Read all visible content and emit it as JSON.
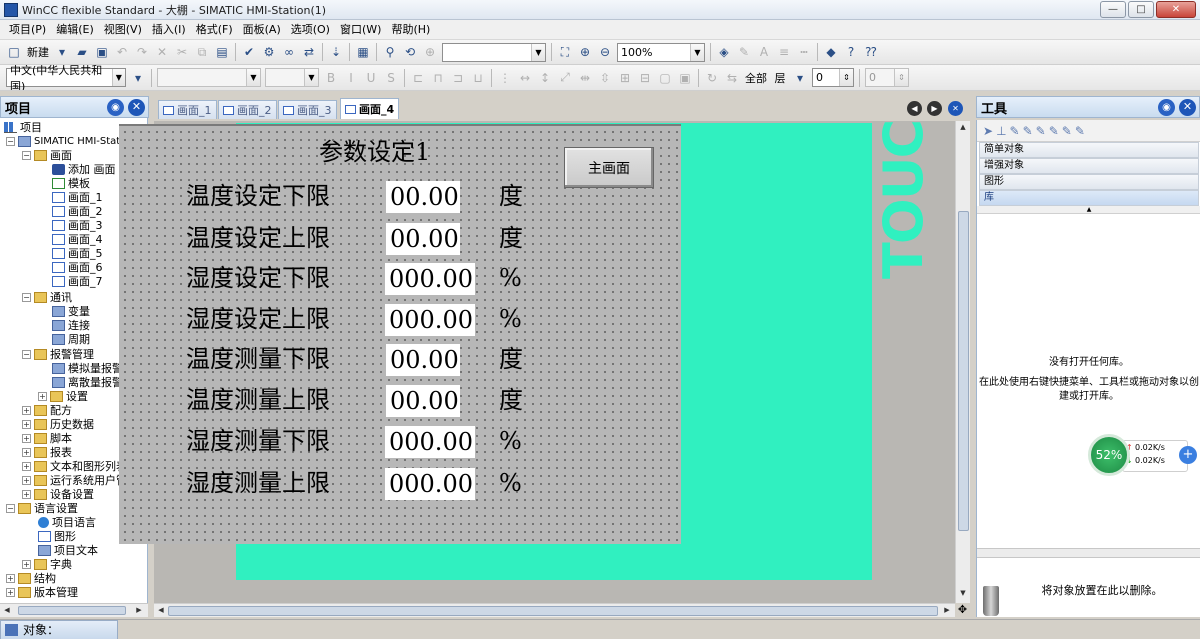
{
  "window": {
    "title": "WinCC flexible Standard - 大棚 - SIMATIC HMI-Station(1)",
    "min": "—",
    "max": "□",
    "close": "✕"
  },
  "menu": [
    "项目(P)",
    "编辑(E)",
    "视图(V)",
    "插入(I)",
    "格式(F)",
    "面板(A)",
    "选项(O)",
    "窗口(W)",
    "帮助(H)"
  ],
  "toolbar1": {
    "new_label": "新建",
    "zoom_value": "100%"
  },
  "toolbar2": {
    "language": "中文(中华人民共和国)",
    "layer_all": "全部",
    "layer_label": "层",
    "layer_value": "0",
    "second_value": "0"
  },
  "project": {
    "header": "项目",
    "root": "项目",
    "station": "SIMATIC HMI-Station(1)",
    "screens_folder": "画面",
    "add_screen": "添加 画面",
    "template": "模板",
    "screens": [
      "画面_1",
      "画面_2",
      "画面_3",
      "画面_4",
      "画面_5",
      "画面_6",
      "画面_7"
    ],
    "comm": "通讯",
    "tags": "变量",
    "connections": "连接",
    "cycles": "周期",
    "alarm_mgmt": "报警管理",
    "analog_alarms": "模拟量报警",
    "discrete_alarms": "离散量报警",
    "settings": "设置",
    "recipes": "配方",
    "historical": "历史数据",
    "scripts": "脚本",
    "reports": "报表",
    "text_graphic_lists": "文本和图形列表",
    "runtime_user_mgmt": "运行系统用户管理",
    "device_settings": "设备设置",
    "language_settings": "语言设置",
    "project_languages": "项目语言",
    "graphics": "图形",
    "project_texts": "项目文本",
    "dictionaries": "字典",
    "structures": "结构",
    "version_mgmt": "版本管理"
  },
  "editor": {
    "tabs": [
      "画面_1",
      "画面_2",
      "画面_3",
      "画面_4"
    ],
    "active_tab": "画面_4",
    "screen_title": "参数设定1",
    "main_button": "主画面",
    "touch_text": "TOUC",
    "params": [
      {
        "label": "温度设定下限",
        "value": "00.00",
        "unit": "度"
      },
      {
        "label": "温度设定上限",
        "value": "00.00",
        "unit": "度"
      },
      {
        "label": "湿度设定下限",
        "value": "000.00",
        "unit": "%"
      },
      {
        "label": "湿度设定上限",
        "value": "000.00",
        "unit": "%"
      },
      {
        "label": "温度测量下限",
        "value": "00.00",
        "unit": "度"
      },
      {
        "label": "温度测量上限",
        "value": "00.00",
        "unit": "度"
      },
      {
        "label": "湿度测量下限",
        "value": "000.00",
        "unit": "%"
      },
      {
        "label": "湿度测量上限",
        "value": "000.00",
        "unit": "%"
      }
    ]
  },
  "tools": {
    "header": "工具",
    "categories": [
      "简单对象",
      "增强对象",
      "图形",
      "库"
    ],
    "no_library": "没有打开任何库。",
    "hint": "在此处使用右键快捷菜单、工具栏或拖动对象以创建或打开库。",
    "drop_hint": "将对象放置在此以删除。"
  },
  "network": {
    "percent": "52%",
    "up": "0.02K/s",
    "down": "0.02K/s"
  },
  "status": {
    "object_label": "对象："
  },
  "colors": {
    "accent": "#30f0c0",
    "canvas": "#b7b7b7",
    "panel_header": "#c9dcef"
  }
}
